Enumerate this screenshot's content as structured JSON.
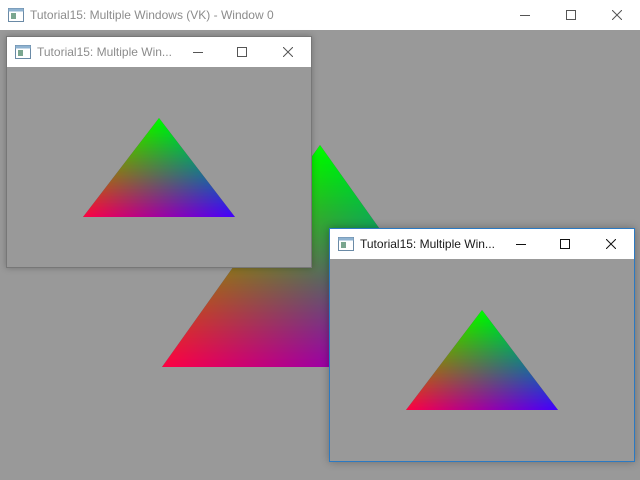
{
  "main_window": {
    "title": "Tutorial15: Multiple Windows (VK) - Window 0"
  },
  "window_1": {
    "title": "Tutorial15: Multiple Win..."
  },
  "window_2": {
    "title": "Tutorial15: Multiple Win..."
  },
  "icons": {
    "app": "app-window-icon",
    "minimize": "minimize-icon",
    "maximize": "maximize-icon",
    "close": "close-icon"
  },
  "colors": {
    "client_background": "#999999",
    "titlebar_background": "#ffffff",
    "active_border": "#2b79c2",
    "triangle_top": "#00ff00",
    "triangle_left": "#ff0000",
    "triangle_right": "#0000ff"
  }
}
